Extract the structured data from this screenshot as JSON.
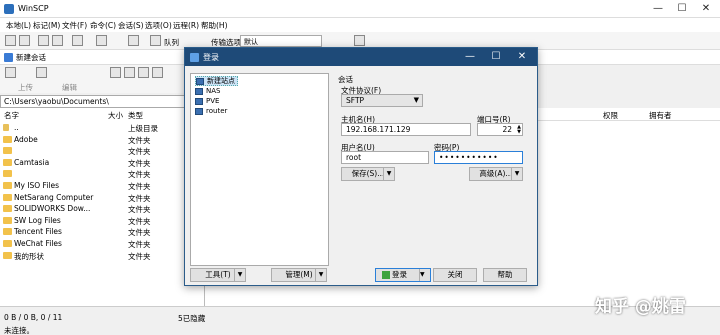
{
  "app": {
    "title": "WinSCP"
  },
  "menu": [
    "本地(L)",
    "标记(M)",
    "文件(F)",
    "命令(C)",
    "会话(S)",
    "选项(O)",
    "远程(R)",
    "帮助(H)"
  ],
  "toolbar": {
    "queue_label": "队列",
    "transfer_label": "传输选项",
    "transfer_value": "默认"
  },
  "tab": {
    "label": "新建会话"
  },
  "left": {
    "path": "C:\\Users\\yaobu\\Documents\\",
    "upload_label": "上传",
    "edit_label": "编辑",
    "columns": {
      "name": "名字",
      "size": "大小",
      "type": "类型"
    },
    "rows": [
      {
        "name": "..",
        "type": "上级目录"
      },
      {
        "name": "Adobe",
        "type": "文件夹"
      },
      {
        "name": "",
        "type": "文件夹"
      },
      {
        "name": "Camtasia",
        "type": "文件夹"
      },
      {
        "name": "",
        "type": "文件夹"
      },
      {
        "name": "My ISO Files",
        "type": "文件夹"
      },
      {
        "name": "NetSarang Computer",
        "type": "文件夹"
      },
      {
        "name": "SOLIDWORKS Dow...",
        "type": "文件夹"
      },
      {
        "name": "SW Log Files",
        "type": "文件夹"
      },
      {
        "name": "Tencent Files",
        "type": "文件夹"
      },
      {
        "name": "WeChat Files",
        "type": "文件夹"
      },
      {
        "name": "我的形状",
        "type": "文件夹"
      }
    ]
  },
  "right": {
    "columns": {
      "rights": "权限",
      "owner": "拥有者"
    }
  },
  "status": {
    "left": "0 B / 0 B,  0 / 11",
    "hidden": "5已隐藏",
    "connection": "未连接。"
  },
  "watermark": "知乎 @姚雷",
  "dialog": {
    "title": "登录",
    "sites": [
      "新建站点",
      "NAS",
      "PVE",
      "router"
    ],
    "session_label": "会话",
    "protocol_label": "文件协议(F)",
    "protocol_value": "SFTP",
    "host_label": "主机名(H)",
    "host_value": "192.168.171.129",
    "port_label": "端口号(R)",
    "port_value": "22",
    "user_label": "用户名(U)",
    "user_value": "root",
    "password_label": "密码(P)",
    "password_value": "•••••••••••",
    "save_label": "保存(S)...",
    "advanced_label": "高级(A)...",
    "tools_label": "工具(T)",
    "manage_label": "管理(M)",
    "login_label": "登录",
    "close_label": "关闭",
    "help_label": "帮助"
  }
}
